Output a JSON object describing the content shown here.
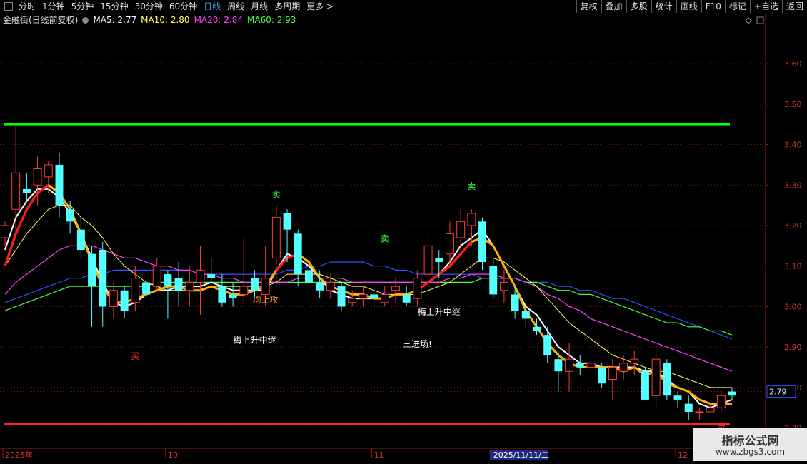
{
  "toolbar": {
    "periods": [
      "分时",
      "1分钟",
      "5分钟",
      "15分钟",
      "30分钟",
      "60分钟",
      "日线",
      "周线",
      "月线",
      "多周期",
      "更多 >"
    ],
    "active_period": "日线",
    "right_buttons": [
      "复权",
      "叠加",
      "多股",
      "统计",
      "画线",
      "F10",
      "标记",
      "+自选",
      "返回"
    ]
  },
  "legend": {
    "title": "金融街(日线前复权)",
    "ma5": "MA5: 2.77",
    "ma10": "MA10: 2.80",
    "ma20": "MA20: 2.84",
    "ma60": "MA60: 2.93"
  },
  "colors": {
    "up": "#ff3b3b",
    "down": "#54ffff",
    "ma5": "#ffffff",
    "ma10": "#ffff60",
    "ma20": "#ff40ff",
    "ma60": "#40ff40",
    "blue_ma": "#3050ff",
    "signal_line": "#ffb000",
    "support": "#ff2020",
    "resistance": "#00ff00"
  },
  "chart_data": {
    "type": "candlestick",
    "ylim": [
      2.65,
      3.69
    ],
    "y_ticks": [
      "3.60",
      "3.50",
      "3.40",
      "3.30",
      "3.20",
      "3.10",
      "3.00",
      "2.90",
      "2.80",
      "2.70"
    ],
    "current_price": "2.79",
    "resistance": 3.45,
    "support": 2.71,
    "x_labels": [
      "2025年",
      "10",
      "11",
      "2025/11/11/二",
      "12"
    ],
    "x_label_index": [
      0,
      15,
      34,
      45,
      62
    ],
    "candles": [
      [
        3.17,
        3.2,
        3.21,
        3.15
      ],
      [
        3.24,
        3.33,
        3.45,
        3.17
      ],
      [
        3.29,
        3.28,
        3.33,
        3.26
      ],
      [
        3.3,
        3.34,
        3.37,
        3.25
      ],
      [
        3.32,
        3.35,
        3.36,
        3.28
      ],
      [
        3.35,
        3.25,
        3.38,
        3.22
      ],
      [
        3.24,
        3.21,
        3.26,
        3.18
      ],
      [
        3.19,
        3.14,
        3.22,
        3.12
      ],
      [
        3.13,
        3.05,
        3.15,
        2.95
      ],
      [
        3.14,
        3.0,
        3.16,
        2.95
      ],
      [
        3.0,
        3.04,
        3.06,
        2.97
      ],
      [
        3.04,
        2.99,
        3.05,
        2.97
      ],
      [
        3.01,
        3.07,
        3.1,
        2.99
      ],
      [
        3.06,
        3.03,
        3.08,
        2.93
      ],
      [
        3.05,
        3.1,
        3.12,
        3.04
      ],
      [
        3.08,
        3.05,
        3.09,
        2.97
      ],
      [
        3.07,
        3.04,
        3.11,
        3.0
      ],
      [
        3.04,
        3.06,
        3.1,
        3.0
      ],
      [
        3.06,
        3.09,
        3.15,
        2.98
      ],
      [
        3.08,
        3.07,
        3.12,
        3.05
      ],
      [
        3.05,
        3.01,
        3.08,
        3.0
      ],
      [
        3.03,
        3.02,
        3.06,
        3.0
      ],
      [
        3.03,
        3.05,
        3.17,
        3.01
      ],
      [
        3.07,
        3.04,
        3.09,
        3.02
      ],
      [
        3.03,
        3.07,
        3.15,
        3.0
      ],
      [
        3.12,
        3.22,
        3.25,
        3.05
      ],
      [
        3.23,
        3.19,
        3.24,
        3.11
      ],
      [
        3.18,
        3.08,
        3.19,
        3.05
      ],
      [
        3.09,
        3.06,
        3.12,
        3.03
      ],
      [
        3.06,
        3.04,
        3.09,
        3.02
      ],
      [
        3.04,
        3.06,
        3.08,
        3.02
      ],
      [
        3.05,
        3.0,
        3.06,
        2.99
      ],
      [
        3.01,
        3.02,
        3.04,
        3.0
      ],
      [
        3.02,
        3.03,
        3.05,
        3.0
      ],
      [
        3.03,
        3.02,
        3.05,
        3.0
      ],
      [
        3.01,
        3.03,
        3.05,
        3.0
      ],
      [
        3.04,
        3.05,
        3.07,
        3.01
      ],
      [
        3.03,
        3.01,
        3.05,
        3.0
      ],
      [
        3.02,
        3.07,
        3.09,
        3.0
      ],
      [
        3.08,
        3.15,
        3.18,
        3.06
      ],
      [
        3.12,
        3.11,
        3.14,
        3.07
      ],
      [
        3.13,
        3.18,
        3.21,
        3.1
      ],
      [
        3.17,
        3.21,
        3.24,
        3.14
      ],
      [
        3.2,
        3.23,
        3.24,
        3.15
      ],
      [
        3.21,
        3.11,
        3.22,
        3.09
      ],
      [
        3.1,
        3.03,
        3.12,
        3.02
      ],
      [
        3.04,
        3.06,
        3.09,
        3.01
      ],
      [
        3.03,
        2.99,
        3.05,
        2.97
      ],
      [
        2.99,
        2.97,
        3.01,
        2.95
      ],
      [
        2.95,
        2.94,
        2.97,
        2.93
      ],
      [
        2.93,
        2.88,
        2.95,
        2.86
      ],
      [
        2.87,
        2.84,
        2.89,
        2.79
      ],
      [
        2.84,
        2.87,
        2.91,
        2.79
      ],
      [
        2.86,
        2.85,
        2.88,
        2.83
      ],
      [
        2.85,
        2.86,
        2.87,
        2.81
      ],
      [
        2.85,
        2.81,
        2.86,
        2.8
      ],
      [
        2.82,
        2.85,
        2.87,
        2.77
      ],
      [
        2.84,
        2.86,
        2.88,
        2.82
      ],
      [
        2.86,
        2.87,
        2.89,
        2.83
      ],
      [
        2.84,
        2.77,
        2.85,
        2.77
      ],
      [
        2.78,
        2.87,
        2.9,
        2.75
      ],
      [
        2.86,
        2.78,
        2.87,
        2.77
      ],
      [
        2.78,
        2.77,
        2.79,
        2.75
      ],
      [
        2.76,
        2.74,
        2.78,
        2.72
      ],
      [
        2.74,
        2.74,
        2.75,
        2.72
      ],
      [
        2.74,
        2.75,
        2.76,
        2.74
      ],
      [
        2.75,
        2.78,
        2.79,
        2.74
      ],
      [
        2.79,
        2.78,
        2.8,
        2.77
      ]
    ],
    "ma5": [
      3.14,
      3.22,
      3.26,
      3.29,
      3.29,
      3.27,
      3.23,
      3.18,
      3.12,
      3.06,
      3.01,
      3.0,
      3.01,
      3.03,
      3.04,
      3.04,
      3.05,
      3.05,
      3.05,
      3.06,
      3.05,
      3.04,
      3.04,
      3.04,
      3.04,
      3.09,
      3.13,
      3.12,
      3.1,
      3.07,
      3.04,
      3.03,
      3.02,
      3.02,
      3.02,
      3.02,
      3.03,
      3.03,
      3.04,
      3.06,
      3.08,
      3.11,
      3.15,
      3.17,
      3.19,
      3.15,
      3.1,
      3.05,
      3.0,
      2.98,
      2.94,
      2.9,
      2.88,
      2.86,
      2.86,
      2.85,
      2.85,
      2.85,
      2.85,
      2.84,
      2.84,
      2.82,
      2.8,
      2.79,
      2.76,
      2.75,
      2.76,
      2.77
    ],
    "ma10": [
      3.1,
      3.14,
      3.18,
      3.21,
      3.24,
      3.25,
      3.25,
      3.22,
      3.2,
      3.17,
      3.13,
      3.1,
      3.08,
      3.06,
      3.05,
      3.04,
      3.04,
      3.04,
      3.04,
      3.05,
      3.05,
      3.05,
      3.05,
      3.05,
      3.05,
      3.06,
      3.08,
      3.08,
      3.08,
      3.08,
      3.07,
      3.06,
      3.05,
      3.05,
      3.04,
      3.03,
      3.03,
      3.03,
      3.03,
      3.04,
      3.05,
      3.06,
      3.08,
      3.1,
      3.12,
      3.12,
      3.11,
      3.09,
      3.07,
      3.05,
      3.02,
      2.99,
      2.96,
      2.94,
      2.92,
      2.9,
      2.88,
      2.87,
      2.86,
      2.85,
      2.84,
      2.84,
      2.83,
      2.82,
      2.81,
      2.8,
      2.8,
      2.8
    ],
    "ma20": [
      3.03,
      3.06,
      3.08,
      3.1,
      3.12,
      3.14,
      3.15,
      3.15,
      3.15,
      3.14,
      3.13,
      3.12,
      3.12,
      3.11,
      3.1,
      3.1,
      3.09,
      3.09,
      3.08,
      3.08,
      3.07,
      3.07,
      3.06,
      3.06,
      3.06,
      3.06,
      3.06,
      3.07,
      3.07,
      3.07,
      3.07,
      3.07,
      3.06,
      3.06,
      3.06,
      3.06,
      3.06,
      3.06,
      3.06,
      3.06,
      3.06,
      3.07,
      3.07,
      3.08,
      3.08,
      3.08,
      3.07,
      3.07,
      3.06,
      3.05,
      3.03,
      3.02,
      3.0,
      2.99,
      2.97,
      2.96,
      2.95,
      2.94,
      2.93,
      2.92,
      2.91,
      2.9,
      2.89,
      2.88,
      2.87,
      2.86,
      2.85,
      2.84
    ],
    "ma60": [
      2.99,
      3.0,
      3.01,
      3.02,
      3.03,
      3.04,
      3.05,
      3.05,
      3.05,
      3.05,
      3.05,
      3.05,
      3.05,
      3.05,
      3.06,
      3.06,
      3.06,
      3.06,
      3.06,
      3.06,
      3.06,
      3.06,
      3.06,
      3.06,
      3.06,
      3.06,
      3.06,
      3.06,
      3.06,
      3.06,
      3.06,
      3.06,
      3.06,
      3.06,
      3.06,
      3.06,
      3.06,
      3.06,
      3.06,
      3.06,
      3.06,
      3.06,
      3.06,
      3.06,
      3.07,
      3.07,
      3.07,
      3.07,
      3.06,
      3.06,
      3.05,
      3.04,
      3.04,
      3.03,
      3.03,
      3.02,
      3.01,
      3.0,
      2.99,
      2.98,
      2.97,
      2.96,
      2.96,
      2.95,
      2.95,
      2.94,
      2.94,
      2.93
    ],
    "blue_ma": [
      3.01,
      3.02,
      3.03,
      3.04,
      3.05,
      3.06,
      3.07,
      3.07,
      3.08,
      3.08,
      3.09,
      3.09,
      3.09,
      3.09,
      3.09,
      3.09,
      3.09,
      3.09,
      3.08,
      3.08,
      3.08,
      3.08,
      3.08,
      3.08,
      3.08,
      3.08,
      3.09,
      3.09,
      3.1,
      3.1,
      3.11,
      3.11,
      3.11,
      3.11,
      3.1,
      3.1,
      3.09,
      3.09,
      3.08,
      3.08,
      3.08,
      3.08,
      3.08,
      3.08,
      3.07,
      3.07,
      3.07,
      3.07,
      3.06,
      3.06,
      3.06,
      3.05,
      3.05,
      3.04,
      3.04,
      3.03,
      3.02,
      3.02,
      3.01,
      3.0,
      2.99,
      2.98,
      2.97,
      2.96,
      2.95,
      2.94,
      2.93,
      2.92
    ],
    "signal_line": [
      3.1,
      3.18,
      3.24,
      3.28,
      3.3,
      3.28,
      3.24,
      3.18,
      3.11,
      3.05,
      3.01,
      3.01,
      3.02,
      3.03,
      3.04,
      3.05,
      3.05,
      3.04,
      3.04,
      3.05,
      3.04,
      3.03,
      3.03,
      3.04,
      3.05,
      3.09,
      3.12,
      3.13,
      3.11,
      3.07,
      3.05,
      3.04,
      3.03,
      3.03,
      3.02,
      3.02,
      3.03,
      3.03,
      3.04,
      3.06,
      3.08,
      3.1,
      3.13,
      3.16,
      3.17,
      3.15,
      3.1,
      3.05,
      2.99,
      2.95,
      2.91,
      2.88,
      2.86,
      2.85,
      2.85,
      2.85,
      2.85,
      2.84,
      2.85,
      2.83,
      2.84,
      2.81,
      2.8,
      2.79,
      2.77,
      2.76,
      2.76,
      2.76
    ],
    "rising_segments": [
      [
        0,
        4
      ],
      [
        25,
        27
      ],
      [
        38,
        43
      ]
    ],
    "annotations": [
      {
        "text": "卖",
        "index": 25,
        "price": 3.27,
        "color": "#40ff40"
      },
      {
        "text": "卖",
        "index": 35,
        "price": 3.16,
        "color": "#40ff40"
      },
      {
        "text": "卖",
        "index": 43,
        "price": 3.29,
        "color": "#40ff40"
      },
      {
        "text": "买",
        "index": 12,
        "price": 2.87,
        "color": "#ff3030"
      },
      {
        "text": "买",
        "index": 66,
        "price": 2.69,
        "color": "#ff3030"
      },
      {
        "text": "均上攻",
        "index": 24,
        "price": 3.01,
        "color": "#ff9030"
      },
      {
        "text": "梅上升中继",
        "index": 23,
        "price": 2.91,
        "color": "#ffffff"
      },
      {
        "text": "梅上升中继",
        "index": 40,
        "price": 2.98,
        "color": "#ffffff"
      },
      {
        "text": "三进场!",
        "index": 38,
        "price": 2.9,
        "color": "#ffffff"
      }
    ]
  },
  "watermark": {
    "line1": "指标公式网",
    "line2": "www.zbgs3.com"
  }
}
